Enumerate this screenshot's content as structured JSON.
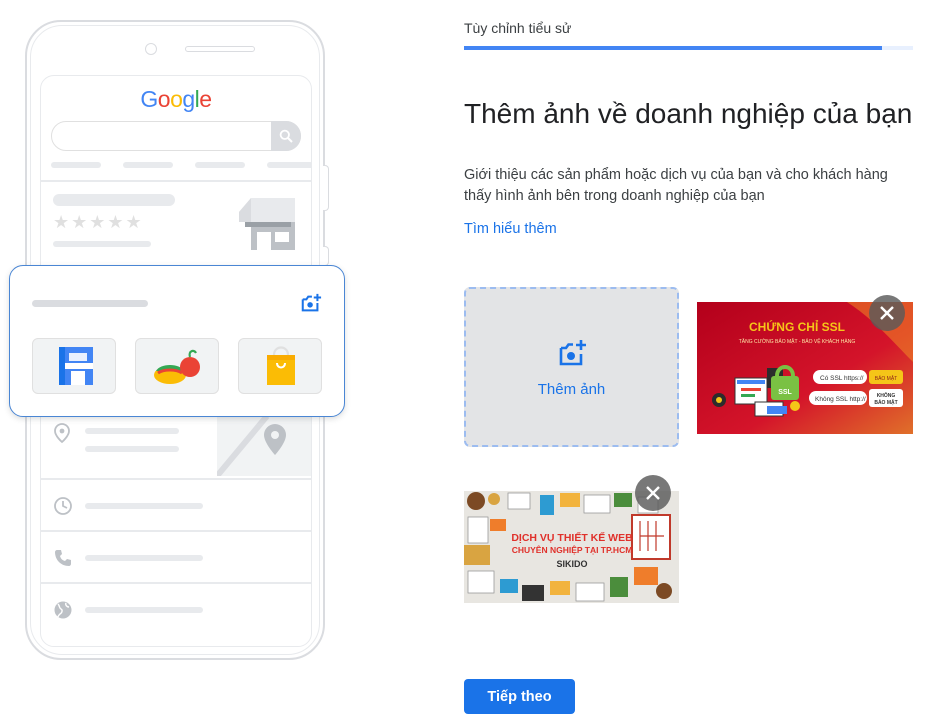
{
  "progress": {
    "step_label": "Tùy chỉnh tiểu sử",
    "fraction": 0.93
  },
  "main": {
    "title": "Thêm ảnh về doanh nghiệp của bạn",
    "description": "Giới thiệu các sản phẩm hoặc dịch vụ của bạn và cho khách hàng thấy hình ảnh bên trong doanh nghiệp của bạn",
    "learn_more": "Tìm hiểu thêm",
    "add_photo_label": "Thêm ảnh",
    "next_button": "Tiếp theo"
  },
  "illustration": {
    "logo_letters": [
      "G",
      "o",
      "o",
      "g",
      "l",
      "e"
    ],
    "logo_colors": [
      "#4285f4",
      "#ea4335",
      "#fbbc05",
      "#4285f4",
      "#34a853",
      "#ea4335"
    ],
    "stars": "★★★★★"
  },
  "photos": [
    {
      "name": "ssl",
      "title": "CHỨNG CHỈ SSL",
      "subtitle": "TĂNG CƯỜNG BẢO MẬT - BẢO VỆ KHÁCH HÀNG",
      "line1": "Có SSL https://",
      "badge1": "BẢO MẬT",
      "line2": "Không SSL http://",
      "badge2a": "KHÔNG",
      "badge2b": "BẢO MẬT",
      "lock_label": "SSL"
    },
    {
      "name": "web",
      "line1": "DỊCH VỤ THIẾT KẾ WEB",
      "line2": "CHUYÊN NGHIỆP TẠI TP.HCM",
      "line3": "SIKIDO"
    }
  ],
  "colors": {
    "accent": "#1a73e8",
    "progress": "#4285f4",
    "ssl_red": "#c8102e",
    "ssl_gold": "#f5c518",
    "web_red": "#e0312b"
  }
}
